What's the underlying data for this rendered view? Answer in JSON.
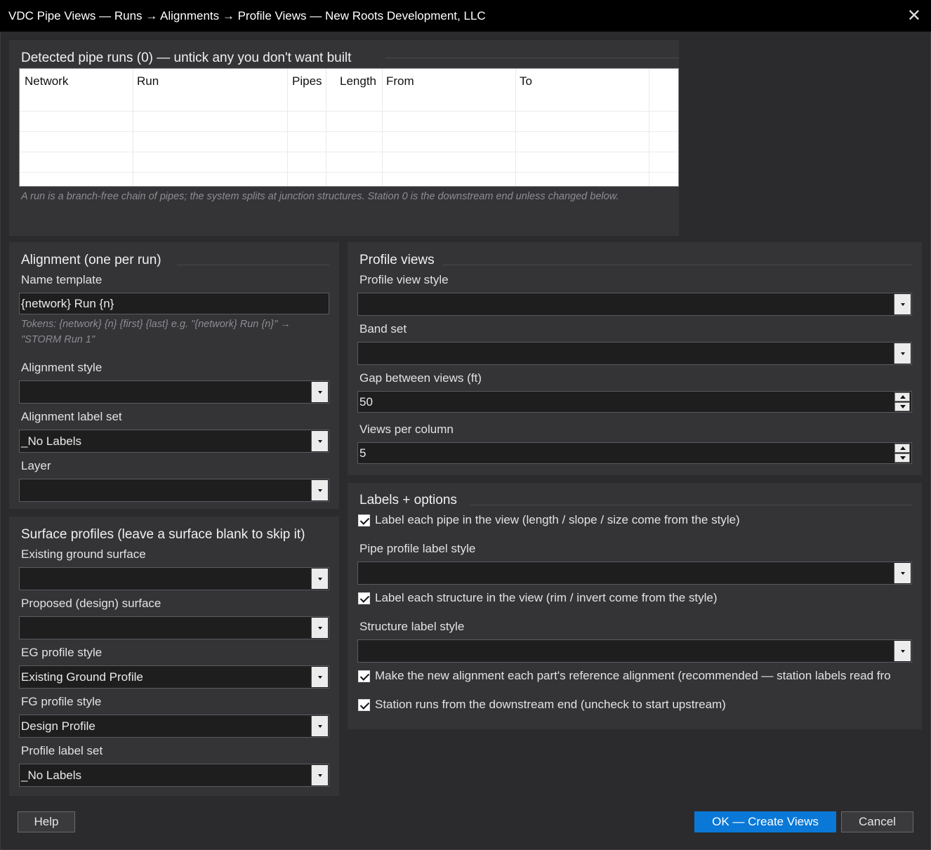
{
  "window": {
    "title": "VDC Pipe Views — Runs → Alignments → Profile Views — New Roots Development, LLC",
    "close_glyph": "✕"
  },
  "runs": {
    "title": "Detected pipe runs (0) — untick any you don't want built",
    "columns": [
      "Network",
      "Run",
      "Pipes",
      "Length",
      "From",
      "To"
    ],
    "rows": [],
    "hint": "A run is a branch-free chain of pipes; the system splits at junction structures. Station 0 is the downstream end unless changed below."
  },
  "alignment": {
    "title": "Alignment (one per run)",
    "name_template_label": "Name template",
    "name_template_value": "{network} Run {n}",
    "tokens_hint": "Tokens: {network}  {n}  {first}  {last}   e.g. \"{network} Run {n}\" → \"STORM Run 1\"",
    "style_label": "Alignment style",
    "style_value": "",
    "label_set_label": "Alignment label set",
    "label_set_value": "_No Labels",
    "layer_label": "Layer",
    "layer_value": ""
  },
  "surfaces": {
    "title": "Surface profiles (leave a surface blank to skip it)",
    "eg_surface_label": "Existing ground surface",
    "eg_surface_value": "",
    "fg_surface_label": "Proposed (design) surface",
    "fg_surface_value": "",
    "eg_style_label": "EG profile style",
    "eg_style_value": "Existing Ground Profile",
    "fg_style_label": "FG profile style",
    "fg_style_value": "Design Profile",
    "label_set_label": "Profile label set",
    "label_set_value": "_No Labels"
  },
  "profile_views": {
    "title": "Profile views",
    "style_label": "Profile view style",
    "style_value": "",
    "band_set_label": "Band set",
    "band_set_value": "",
    "gap_label": "Gap between views (ft)",
    "gap_value": "50",
    "per_column_label": "Views per column",
    "per_column_value": "5"
  },
  "labels_options": {
    "title": "Labels + options",
    "label_pipes": "Label each pipe in the view (length / slope / size come from the style)",
    "label_pipes_checked": true,
    "pipe_label_style_label": "Pipe profile label style",
    "pipe_label_style_value": "",
    "label_structures": "Label each structure in the view (rim / invert come from the style)",
    "label_structures_checked": true,
    "structure_label_style_label": "Structure label style",
    "structure_label_style_value": "",
    "reference_alignment": "Make the new alignment each part's reference alignment (recommended — station labels read fro",
    "reference_alignment_checked": true,
    "downstream_station": "Station runs from the downstream end (uncheck to start upstream)",
    "downstream_station_checked": true
  },
  "footer": {
    "help": "Help",
    "ok": "OK — Create Views",
    "cancel": "Cancel"
  },
  "colors": {
    "accent": "#0a78d7",
    "background": "#2b2b2d",
    "panel": "#343437",
    "titlebar": "#000000"
  }
}
